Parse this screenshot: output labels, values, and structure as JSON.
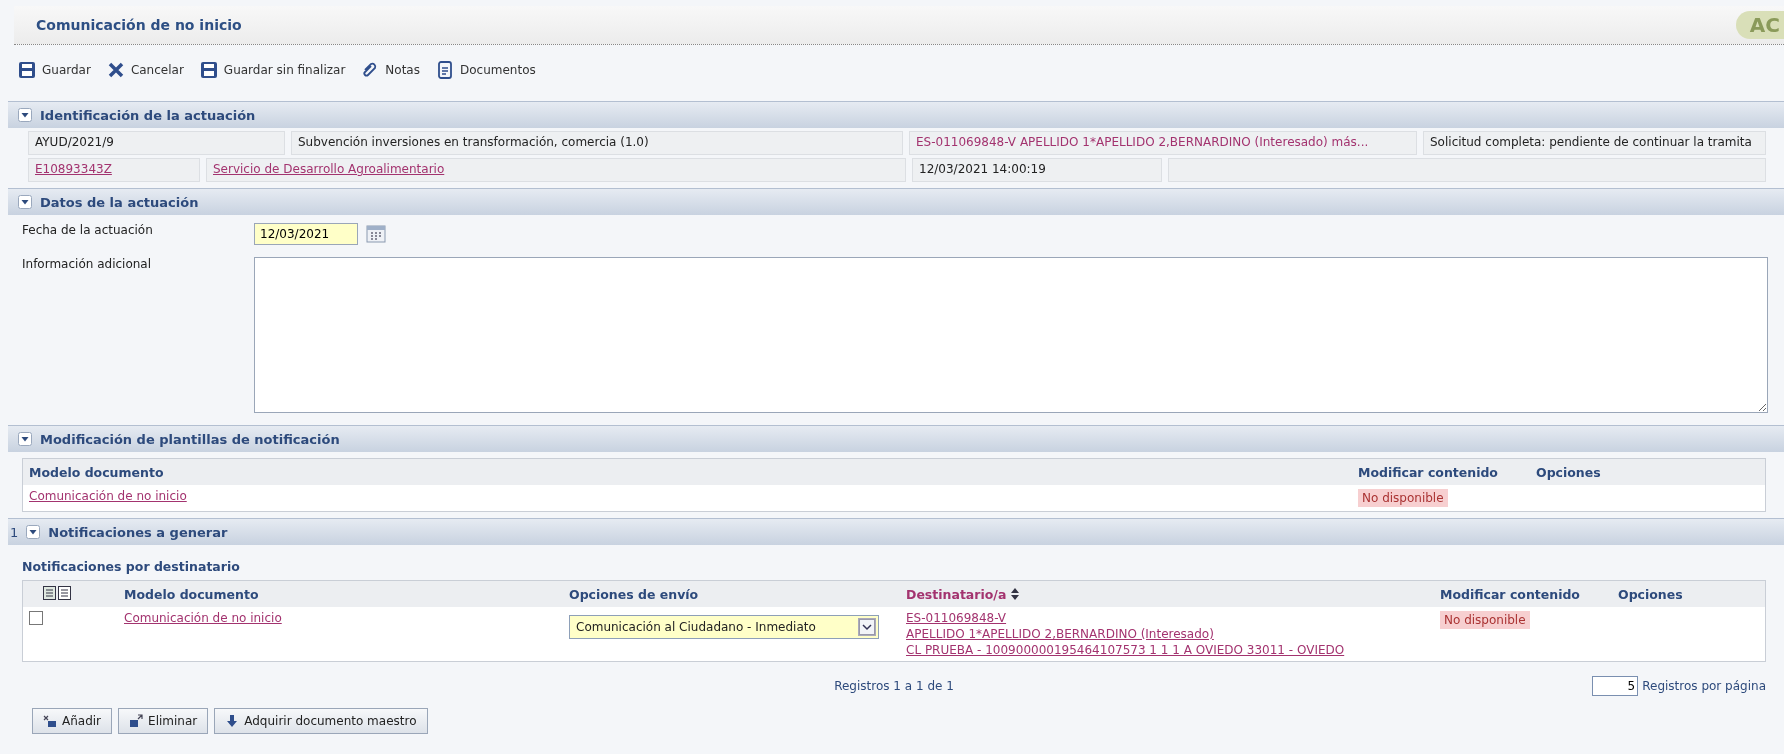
{
  "title": "Comunicación de no inicio",
  "corner_tab": "AC",
  "toolbar": [
    {
      "label": "Guardar",
      "kind": "save"
    },
    {
      "label": "Cancelar",
      "kind": "cancel"
    },
    {
      "label": "Guardar sin finalizar",
      "kind": "save"
    },
    {
      "label": "Notas",
      "kind": "clip"
    },
    {
      "label": "Documentos",
      "kind": "doc"
    }
  ],
  "identificacion": {
    "header": "Identificación de la actuación",
    "expanded": true,
    "rows": [
      [
        {
          "text": "AYUD/2021/9",
          "kind": "text"
        },
        {
          "text": "Subvención inversiones en transformación, comercia (1.0)",
          "kind": "text"
        },
        {
          "text": "ES-011069848-V APELLIDO 1*APELLIDO 2,BERNARDINO (Interesado) más...",
          "kind": "colored"
        },
        {
          "text": "Solicitud completa: pendiente de continuar la tramita",
          "kind": "text"
        }
      ],
      [
        {
          "text": "E10893343Z",
          "kind": "link"
        },
        {
          "text": "Servicio de Desarrollo Agroalimentario",
          "kind": "link"
        },
        {
          "text": "12/03/2021 14:00:19",
          "kind": "text"
        },
        {
          "kind": "empty"
        }
      ]
    ]
  },
  "datos": {
    "header": "Datos de la actuación",
    "expanded": true,
    "fecha": {
      "label": "Fecha de la actuación",
      "value": "12/03/2021"
    },
    "info": {
      "label": "Información adicional"
    }
  },
  "modificacion": {
    "header": "Modificación de plantillas de notificación",
    "expanded": true,
    "columns": [
      "Modelo documento",
      "Modificar contenido",
      "Opciones"
    ],
    "rows": [
      {
        "modelo": "Comunicación de no inicio",
        "modificar": "No disponible"
      }
    ]
  },
  "notificaciones": {
    "count": "1",
    "header": "Notificaciones a generar",
    "expanded": true,
    "subtitle": "Notificaciones por destinatario",
    "columns": [
      {
        "label": "Modelo documento",
        "sortable": false
      },
      {
        "label": "Opciones de envío",
        "sortable": false
      },
      {
        "label": "Destinatario/a",
        "sortable": true
      },
      {
        "label": "Modificar contenido",
        "sortable": false
      },
      {
        "label": "Opciones",
        "sortable": false
      }
    ],
    "rows": [
      {
        "checked": false,
        "modelo": "Comunicación de no inicio",
        "envio": "Comunicación al Ciudadano - Inmediato",
        "destinatario": [
          "ES-011069848-V",
          "APELLIDO 1*APELLIDO 2,BERNARDINO (Interesado)",
          "CL PRUEBA - 100900000195464107573 1 1 1 A OVIEDO 33011 - OVIEDO"
        ],
        "modificar": "No disponible"
      }
    ],
    "pager": "Registros 1 a 1 de 1",
    "per_page": "5",
    "per_page_label": "Registros por página",
    "buttons": [
      {
        "label": "Añadir",
        "kind": "add"
      },
      {
        "label": "Eliminar",
        "kind": "remove"
      },
      {
        "label": "Adquirir documento maestro",
        "kind": "download"
      }
    ]
  }
}
